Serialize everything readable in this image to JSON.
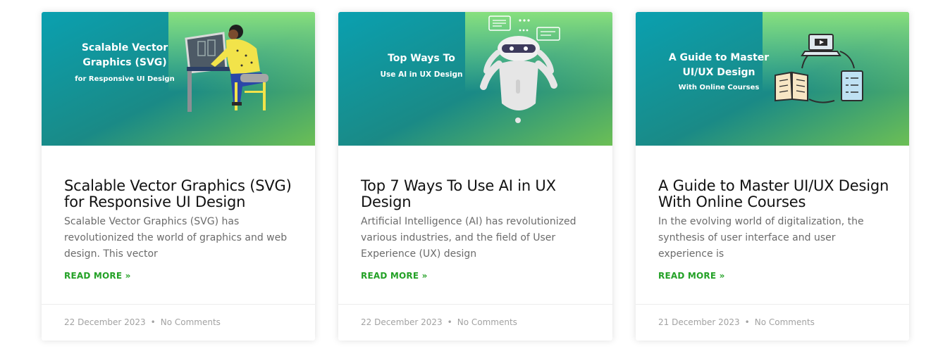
{
  "colors": {
    "banner_gradient_start": "#0b9cab",
    "banner_gradient_mid": "#178a8a",
    "banner_gradient_end": "#8ee272",
    "read_more": "#23a126",
    "title": "#111111",
    "excerpt": "#6b6b6b",
    "meta": "#a2a2a2"
  },
  "posts": [
    {
      "banner": {
        "line1": "Scalable Vector",
        "line2": "Graphics (SVG)",
        "line3": "for Responsive UI Design",
        "illustration": "person-at-drawing-desk"
      },
      "title": "Scalable Vector Graphics (SVG) for Responsive UI Design",
      "excerpt": "Scalable Vector Graphics (SVG) has revolutionized the world of graphics and web design. This vector",
      "read_more": "READ MORE »",
      "date": "22 December 2023",
      "separator": "•",
      "comments": "No Comments"
    },
    {
      "banner": {
        "line1": "Top Ways To",
        "line2": "Use AI in UX Design",
        "illustration": "robot-with-chat-bubbles"
      },
      "title": "Top 7 Ways To Use AI in UX Design",
      "excerpt": "Artificial Intelligence (AI) has revolutionized various industries, and the field of User Experience (UX) design",
      "read_more": "READ MORE »",
      "date": "22 December 2023",
      "separator": "•",
      "comments": "No Comments"
    },
    {
      "banner": {
        "line1": "A Guide to Master",
        "line2": "UI/UX Design",
        "line3": "With Online Courses",
        "illustration": "laptop-book-checklist-cycle"
      },
      "title": "A Guide to Master UI/UX Design With Online Courses",
      "excerpt": "In the evolving world of digitalization, the synthesis of user interface and user experience is",
      "read_more": "READ MORE »",
      "date": "21 December 2023",
      "separator": "•",
      "comments": "No Comments"
    }
  ]
}
